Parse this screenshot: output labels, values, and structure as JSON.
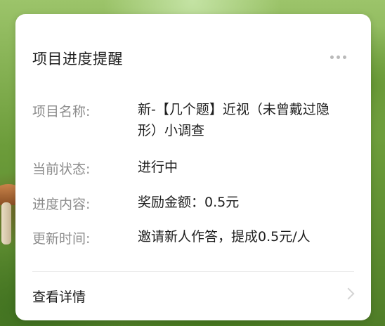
{
  "card": {
    "title": "项目进度提醒",
    "rows": [
      {
        "label": "项目名称:",
        "value": "新-【几个题】近视（未曾戴过隐形）小调查"
      },
      {
        "label": "当前状态:",
        "value": "进行中"
      },
      {
        "label": "进度内容:",
        "value": "奖励金额：0.5元"
      },
      {
        "label": "更新时间:",
        "value": "邀请新人作答，提成0.5元/人"
      }
    ],
    "detail_link": "查看详情"
  },
  "icons": {
    "more": "more-dots-icon",
    "chevron": "chevron-right-icon"
  }
}
